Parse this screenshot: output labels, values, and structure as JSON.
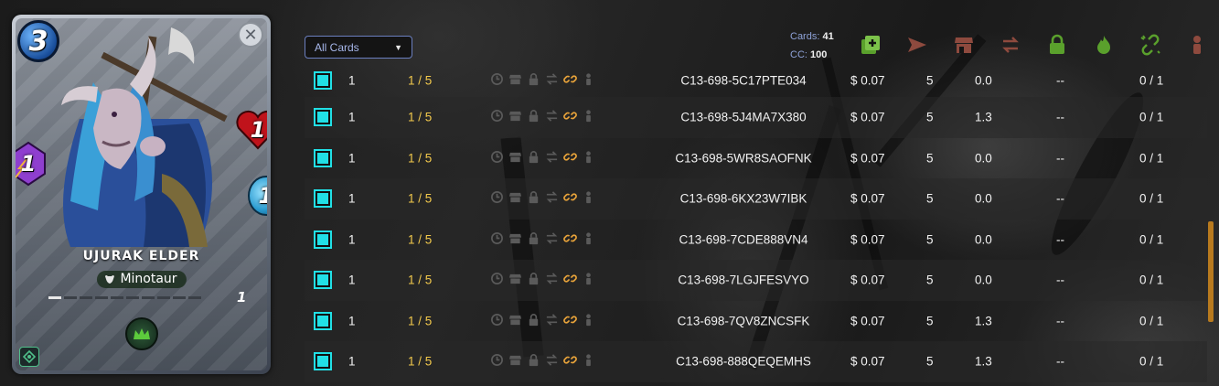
{
  "card": {
    "name": "UJURAK ELDER",
    "type": "Minotaur",
    "mana": "3",
    "health": "1",
    "speed": "1",
    "magic": "1",
    "level": "1",
    "xp_segments_total": 10,
    "xp_segments_filled": 1,
    "close_symbol": "✕"
  },
  "toolbar": {
    "filter": {
      "selected": "All Cards"
    },
    "summary": {
      "cards_label": "Cards:",
      "cards_value": "41",
      "cc_label": "CC:",
      "cc_value": "100"
    },
    "tools": [
      {
        "name": "add-to-deck-icon",
        "color": "#5aa02c"
      },
      {
        "name": "send-icon",
        "color": "#8e4a3e"
      },
      {
        "name": "market-icon",
        "color": "#8e4a3e"
      },
      {
        "name": "transfer-icon",
        "color": "#8e4a3e"
      },
      {
        "name": "lock-icon",
        "color": "#5aa02c"
      },
      {
        "name": "burn-icon",
        "color": "#5aa02c"
      },
      {
        "name": "unlink-icon",
        "color": "#5aa02c"
      },
      {
        "name": "delegate-icon",
        "color": "#8e4a3e"
      }
    ]
  },
  "rows": [
    {
      "qty": "1",
      "lvl_a": "1",
      "lvl_b": "5",
      "uid": "C13-698-5C17PTE034",
      "price": "$ 0.07",
      "cp": "5",
      "bcx": "0.0",
      "dash": "--",
      "burn": "0 / 1"
    },
    {
      "qty": "1",
      "lvl_a": "1",
      "lvl_b": "5",
      "uid": "C13-698-5J4MA7X380",
      "price": "$ 0.07",
      "cp": "5",
      "bcx": "1.3",
      "dash": "--",
      "burn": "0 / 1"
    },
    {
      "qty": "1",
      "lvl_a": "1",
      "lvl_b": "5",
      "uid": "C13-698-5WR8SAOFNK",
      "price": "$ 0.07",
      "cp": "5",
      "bcx": "0.0",
      "dash": "--",
      "burn": "0 / 1"
    },
    {
      "qty": "1",
      "lvl_a": "1",
      "lvl_b": "5",
      "uid": "C13-698-6KX23W7IBK",
      "price": "$ 0.07",
      "cp": "5",
      "bcx": "0.0",
      "dash": "--",
      "burn": "0 / 1"
    },
    {
      "qty": "1",
      "lvl_a": "1",
      "lvl_b": "5",
      "uid": "C13-698-7CDE888VN4",
      "price": "$ 0.07",
      "cp": "5",
      "bcx": "0.0",
      "dash": "--",
      "burn": "0 / 1"
    },
    {
      "qty": "1",
      "lvl_a": "1",
      "lvl_b": "5",
      "uid": "C13-698-7LGJFESVYO",
      "price": "$ 0.07",
      "cp": "5",
      "bcx": "0.0",
      "dash": "--",
      "burn": "0 / 1"
    },
    {
      "qty": "1",
      "lvl_a": "1",
      "lvl_b": "5",
      "uid": "C13-698-7QV8ZNCSFK",
      "price": "$ 0.07",
      "cp": "5",
      "bcx": "1.3",
      "dash": "--",
      "burn": "0 / 1"
    },
    {
      "qty": "1",
      "lvl_a": "1",
      "lvl_b": "5",
      "uid": "C13-698-888QEQEMHS",
      "price": "$ 0.07",
      "cp": "5",
      "bcx": "1.3",
      "dash": "--",
      "burn": "0 / 1"
    }
  ],
  "row_icons": [
    "clock-icon",
    "market-icon",
    "lock-icon",
    "transfer-icon",
    "link-icon",
    "delegate-icon"
  ],
  "colors": {
    "accent_cyan": "#21e0e6",
    "level_gold": "#f2c94c",
    "link_orange": "#e8a33a",
    "scroll_orange": "#b87a1e"
  }
}
